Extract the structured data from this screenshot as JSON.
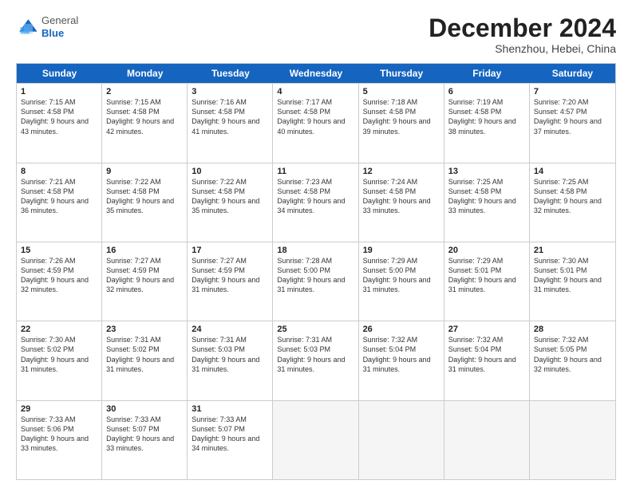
{
  "logo": {
    "general": "General",
    "blue": "Blue"
  },
  "title": "December 2024",
  "location": "Shenzhou, Hebei, China",
  "header_days": [
    "Sunday",
    "Monday",
    "Tuesday",
    "Wednesday",
    "Thursday",
    "Friday",
    "Saturday"
  ],
  "weeks": [
    [
      {
        "day": 1,
        "sunrise": "7:15 AM",
        "sunset": "4:58 PM",
        "daylight": "9 hours and 43 minutes."
      },
      {
        "day": 2,
        "sunrise": "7:15 AM",
        "sunset": "4:58 PM",
        "daylight": "9 hours and 42 minutes."
      },
      {
        "day": 3,
        "sunrise": "7:16 AM",
        "sunset": "4:58 PM",
        "daylight": "9 hours and 41 minutes."
      },
      {
        "day": 4,
        "sunrise": "7:17 AM",
        "sunset": "4:58 PM",
        "daylight": "9 hours and 40 minutes."
      },
      {
        "day": 5,
        "sunrise": "7:18 AM",
        "sunset": "4:58 PM",
        "daylight": "9 hours and 39 minutes."
      },
      {
        "day": 6,
        "sunrise": "7:19 AM",
        "sunset": "4:58 PM",
        "daylight": "9 hours and 38 minutes."
      },
      {
        "day": 7,
        "sunrise": "7:20 AM",
        "sunset": "4:57 PM",
        "daylight": "9 hours and 37 minutes."
      }
    ],
    [
      {
        "day": 8,
        "sunrise": "7:21 AM",
        "sunset": "4:58 PM",
        "daylight": "9 hours and 36 minutes."
      },
      {
        "day": 9,
        "sunrise": "7:22 AM",
        "sunset": "4:58 PM",
        "daylight": "9 hours and 35 minutes."
      },
      {
        "day": 10,
        "sunrise": "7:22 AM",
        "sunset": "4:58 PM",
        "daylight": "9 hours and 35 minutes."
      },
      {
        "day": 11,
        "sunrise": "7:23 AM",
        "sunset": "4:58 PM",
        "daylight": "9 hours and 34 minutes."
      },
      {
        "day": 12,
        "sunrise": "7:24 AM",
        "sunset": "4:58 PM",
        "daylight": "9 hours and 33 minutes."
      },
      {
        "day": 13,
        "sunrise": "7:25 AM",
        "sunset": "4:58 PM",
        "daylight": "9 hours and 33 minutes."
      },
      {
        "day": 14,
        "sunrise": "7:25 AM",
        "sunset": "4:58 PM",
        "daylight": "9 hours and 32 minutes."
      }
    ],
    [
      {
        "day": 15,
        "sunrise": "7:26 AM",
        "sunset": "4:59 PM",
        "daylight": "9 hours and 32 minutes."
      },
      {
        "day": 16,
        "sunrise": "7:27 AM",
        "sunset": "4:59 PM",
        "daylight": "9 hours and 32 minutes."
      },
      {
        "day": 17,
        "sunrise": "7:27 AM",
        "sunset": "4:59 PM",
        "daylight": "9 hours and 31 minutes."
      },
      {
        "day": 18,
        "sunrise": "7:28 AM",
        "sunset": "5:00 PM",
        "daylight": "9 hours and 31 minutes."
      },
      {
        "day": 19,
        "sunrise": "7:29 AM",
        "sunset": "5:00 PM",
        "daylight": "9 hours and 31 minutes."
      },
      {
        "day": 20,
        "sunrise": "7:29 AM",
        "sunset": "5:01 PM",
        "daylight": "9 hours and 31 minutes."
      },
      {
        "day": 21,
        "sunrise": "7:30 AM",
        "sunset": "5:01 PM",
        "daylight": "9 hours and 31 minutes."
      }
    ],
    [
      {
        "day": 22,
        "sunrise": "7:30 AM",
        "sunset": "5:02 PM",
        "daylight": "9 hours and 31 minutes."
      },
      {
        "day": 23,
        "sunrise": "7:31 AM",
        "sunset": "5:02 PM",
        "daylight": "9 hours and 31 minutes."
      },
      {
        "day": 24,
        "sunrise": "7:31 AM",
        "sunset": "5:03 PM",
        "daylight": "9 hours and 31 minutes."
      },
      {
        "day": 25,
        "sunrise": "7:31 AM",
        "sunset": "5:03 PM",
        "daylight": "9 hours and 31 minutes."
      },
      {
        "day": 26,
        "sunrise": "7:32 AM",
        "sunset": "5:04 PM",
        "daylight": "9 hours and 31 minutes."
      },
      {
        "day": 27,
        "sunrise": "7:32 AM",
        "sunset": "5:04 PM",
        "daylight": "9 hours and 31 minutes."
      },
      {
        "day": 28,
        "sunrise": "7:32 AM",
        "sunset": "5:05 PM",
        "daylight": "9 hours and 32 minutes."
      }
    ],
    [
      {
        "day": 29,
        "sunrise": "7:33 AM",
        "sunset": "5:06 PM",
        "daylight": "9 hours and 33 minutes."
      },
      {
        "day": 30,
        "sunrise": "7:33 AM",
        "sunset": "5:07 PM",
        "daylight": "9 hours and 33 minutes."
      },
      {
        "day": 31,
        "sunrise": "7:33 AM",
        "sunset": "5:07 PM",
        "daylight": "9 hours and 34 minutes."
      },
      null,
      null,
      null,
      null
    ]
  ]
}
